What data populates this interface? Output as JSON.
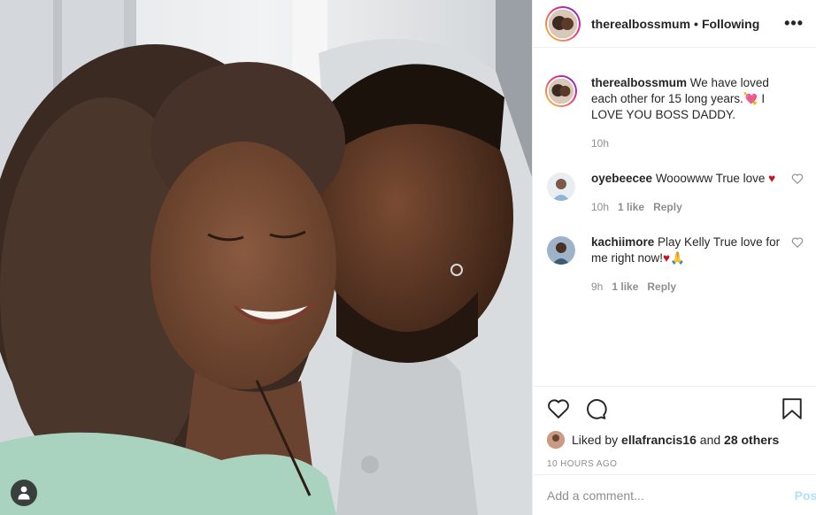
{
  "post": {
    "username": "therealbossmum",
    "follow_state": "Following",
    "dot": "•",
    "more": "•••"
  },
  "caption": {
    "username": "therealbossmum",
    "text_a": " We have loved each other for 15 long years.",
    "emoji": "💘",
    "text_b": " I LOVE YOU BOSS DADDY.",
    "time": "10h"
  },
  "comments": [
    {
      "username": "oyebeecee",
      "text": " Wooowww True love ",
      "emoji": "♥",
      "time": "10h",
      "likes": "1 like",
      "reply": "Reply"
    },
    {
      "username": "kachiimore",
      "text": " Play Kelly True love for me right now!",
      "emoji": "♥",
      "tail": "🙏",
      "time": "9h",
      "likes": "1 like",
      "reply": "Reply"
    }
  ],
  "likes": {
    "prefix": "Liked by ",
    "user": "ellafrancis16",
    "mid": " and ",
    "others": "28 others"
  },
  "timestamp": "10 HOURS AGO",
  "composer": {
    "placeholder": "Add a comment...",
    "post_label": "Post"
  },
  "colors": {
    "link_blue_disabled": "#b2dffc",
    "heart_red": "#c7151d",
    "muted": "#8e8e8e"
  }
}
